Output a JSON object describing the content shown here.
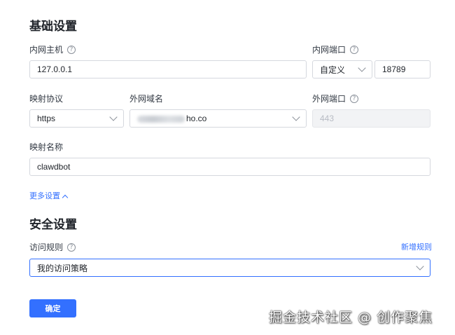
{
  "basic": {
    "title": "基础设置",
    "inner_host_label": "内网主机",
    "inner_host_value": "127.0.0.1",
    "inner_port_label": "内网端口",
    "inner_port_mode": "自定义",
    "inner_port_value": "18789",
    "protocol_label": "映射协议",
    "protocol_value": "https",
    "domain_label": "外网域名",
    "domain_value_visible": "ho.co",
    "outer_port_label": "外网端口",
    "outer_port_value": "443",
    "name_label": "映射名称",
    "name_value": "clawdbot",
    "more_settings": "更多设置"
  },
  "security": {
    "title": "安全设置",
    "rules_label": "访问规则",
    "add_rule": "新增规则",
    "rule_value": "我的访问策略"
  },
  "actions": {
    "confirm": "确定"
  },
  "watermark": "掘金技术社区 @ 创作聚焦",
  "colors": {
    "accent": "#3370ff",
    "border": "#d5d8de",
    "disabled_bg": "#f2f3f5"
  },
  "icons": {
    "help": "question-circle-icon",
    "dropdown": "chevron-down-icon",
    "collapse": "chevron-up-icon"
  }
}
